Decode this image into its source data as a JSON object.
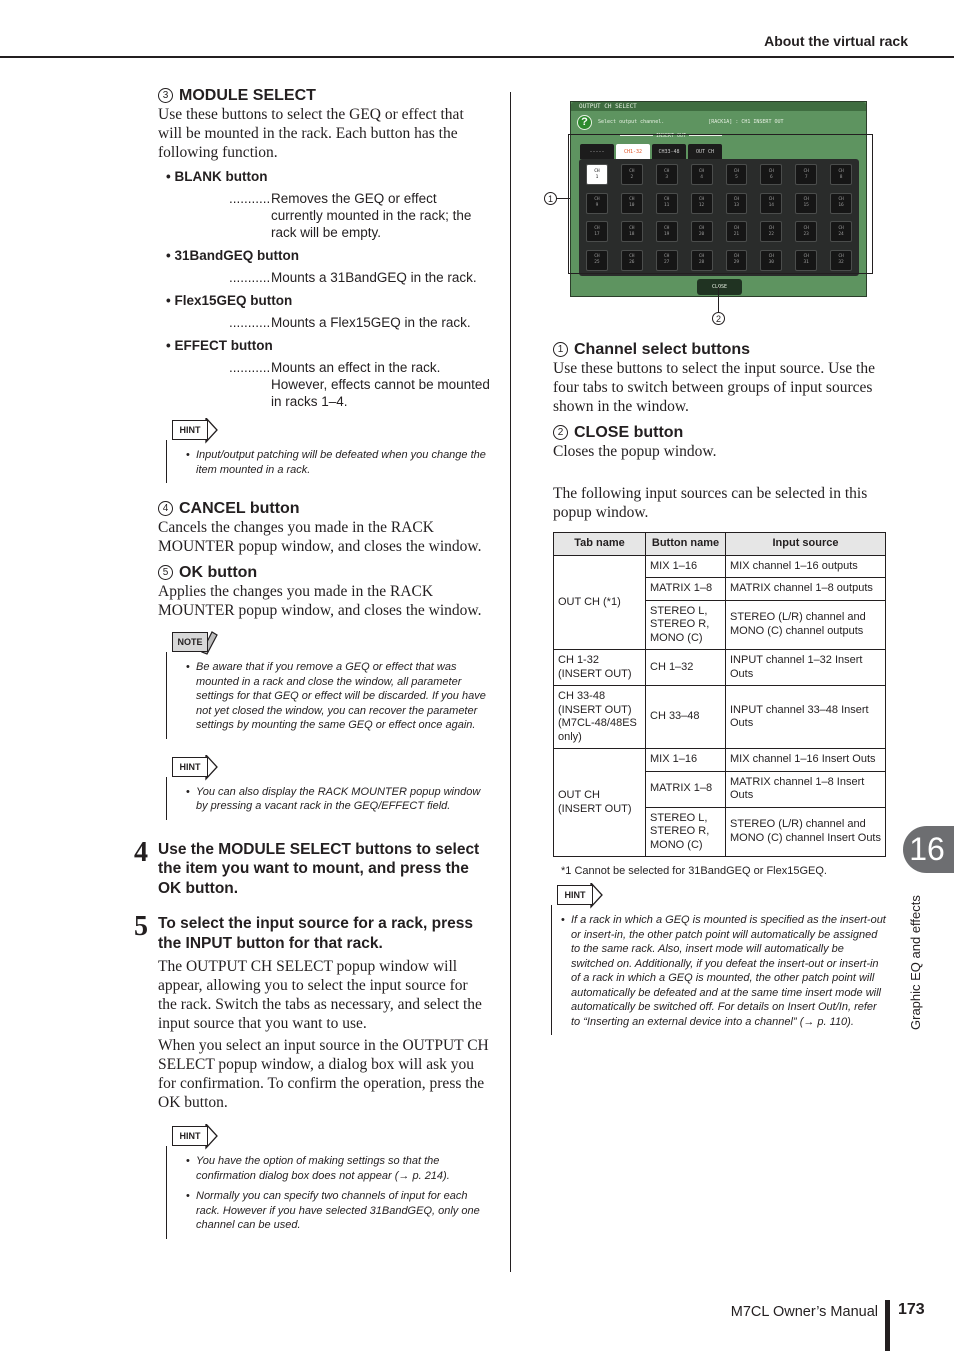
{
  "header": {
    "title": "About the virtual rack"
  },
  "left": {
    "module_select": {
      "num": "3",
      "title": "MODULE SELECT",
      "intro": "Use these buttons to select the GEQ or effect that will be mounted in the rack. Each button has the following function.",
      "items": [
        {
          "title": "BLANK button",
          "desc": "Removes the GEQ or effect currently mounted in the rack; the rack will be empty."
        },
        {
          "title": "31BandGEQ button",
          "desc": "Mounts a 31BandGEQ in the rack."
        },
        {
          "title": "Flex15GEQ button",
          "desc": "Mounts a Flex15GEQ in the rack."
        },
        {
          "title": "EFFECT button",
          "desc": "Mounts an effect in the rack. However, effects cannot be mounted in racks 1–4."
        }
      ],
      "dots": "..........."
    },
    "hint1": {
      "tag": "HINT",
      "items": [
        "Input/output patching will be defeated when you change the item mounted in a rack."
      ]
    },
    "cancel": {
      "num": "4",
      "title": "CANCEL button",
      "text": "Cancels the changes you made in the RACK MOUNTER popup window, and closes the window."
    },
    "ok": {
      "num": "5",
      "title": "OK button",
      "text": "Applies the changes you made in the RACK MOUNTER popup window, and closes the window."
    },
    "note1": {
      "tag": "NOTE",
      "items": [
        "Be aware that if you remove a GEQ or effect that was mounted in a rack and close the window, all parameter settings for that GEQ or effect will be discarded. If you have not yet closed the window, you can recover the parameter settings by mounting the same GEQ or effect once again."
      ]
    },
    "hint2": {
      "tag": "HINT",
      "items": [
        "You can also display the RACK MOUNTER popup window by pressing a vacant rack in the GEQ/EFFECT field."
      ]
    },
    "step4": {
      "num": "4",
      "title": "Use the MODULE SELECT buttons to select the item you want to mount, and press the OK button."
    },
    "step5": {
      "num": "5",
      "title": "To select the input source for a rack, press the INPUT button for that rack.",
      "p1": "The OUTPUT CH SELECT popup window will appear, allowing you to select the input source for the rack. Switch the tabs as necessary, and select the input source that you want to use.",
      "p2": "When you select an input source in the OUTPUT CH SELECT popup window, a dialog box will ask you for confirmation. To confirm the operation, press the OK button."
    },
    "hint3": {
      "tag": "HINT",
      "items": [
        "You have the option of making settings so that the confirmation dialog box does not appear (→ p. 214).",
        "Normally you can specify two channels of input for each rack. However if you have selected 31BandGEQ, only one channel can be used."
      ]
    }
  },
  "screenshot": {
    "window_title": "OUTPUT CH SELECT",
    "prompt": "Select output channel.",
    "status": "[RACK1A] : CH1 INSERT OUT",
    "insert_out_label": "INSERT OUT",
    "tabs": [
      {
        "label": "-----",
        "active": false
      },
      {
        "label": "CH1-32",
        "active": true
      },
      {
        "label": "CH33-48",
        "active": false
      },
      {
        "label": "OUT CH",
        "active": false
      }
    ],
    "channel_prefix": "CH",
    "channels": [
      "1",
      "2",
      "3",
      "4",
      "5",
      "6",
      "7",
      "8",
      "9",
      "10",
      "11",
      "12",
      "13",
      "14",
      "15",
      "16",
      "17",
      "18",
      "19",
      "20",
      "21",
      "22",
      "23",
      "24",
      "25",
      "26",
      "27",
      "28",
      "29",
      "30",
      "31",
      "32"
    ],
    "selected_channel": "1",
    "close_label": "CLOSE",
    "callout1": "1",
    "callout2": "2"
  },
  "right": {
    "channel_select": {
      "num": "1",
      "title": "Channel select buttons",
      "text": "Use these buttons to select the input source. Use the four tabs to switch between groups of input sources shown in the window."
    },
    "close": {
      "num": "2",
      "title": "CLOSE button",
      "text": "Closes the popup window."
    },
    "intro": "The following input sources can be selected in this popup window.",
    "table": {
      "headers": [
        "Tab name",
        "Button name",
        "Input source"
      ],
      "groups": [
        {
          "tab": "OUT CH (*1)",
          "rows": [
            {
              "button": "MIX 1–16",
              "source": "MIX channel 1–16 outputs"
            },
            {
              "button": "MATRIX 1–8",
              "source": "MATRIX channel 1–8 outputs"
            },
            {
              "button": "STEREO L, STEREO R, MONO (C)",
              "source": "STEREO (L/R) channel and MONO (C) channel outputs"
            }
          ]
        },
        {
          "tab": "CH 1-32 (INSERT OUT)",
          "rows": [
            {
              "button": "CH 1–32",
              "source": "INPUT channel 1–32 Insert Outs"
            }
          ]
        },
        {
          "tab": "CH 33-48 (INSERT OUT) (M7CL-48/48ES only)",
          "rows": [
            {
              "button": "CH 33–48",
              "source": "INPUT channel 33–48 Insert Outs"
            }
          ]
        },
        {
          "tab": "OUT CH (INSERT OUT)",
          "rows": [
            {
              "button": "MIX 1–16",
              "source": "MIX channel 1–16 Insert Outs"
            },
            {
              "button": "MATRIX 1–8",
              "source": "MATRIX channel 1–8 Insert Outs"
            },
            {
              "button": "STEREO L, STEREO R, MONO (C)",
              "source": "STEREO (L/R) channel and MONO (C) channel Insert Outs"
            }
          ]
        }
      ]
    },
    "footnote": "*1   Cannot be selected for 31BandGEQ or Flex15GEQ.",
    "hint4": {
      "tag": "HINT",
      "items": [
        "If a rack in which a GEQ is mounted is specified as the insert-out or insert-in, the other patch point will automatically be assigned to the same rack. Also, insert mode will automatically be switched on. Additionally, if you defeat the insert-out or insert-in of a rack in which a GEQ is mounted, the other patch point will automatically be defeated and at the same time insert mode will automatically be switched off. For details on Insert Out/In, refer to “Inserting an external device into a channel” (→ p. 110)."
      ]
    }
  },
  "chapter": {
    "number": "16",
    "label": "Graphic EQ and effects"
  },
  "footer": {
    "manual": "M7CL  Owner’s Manual",
    "page": "173"
  }
}
